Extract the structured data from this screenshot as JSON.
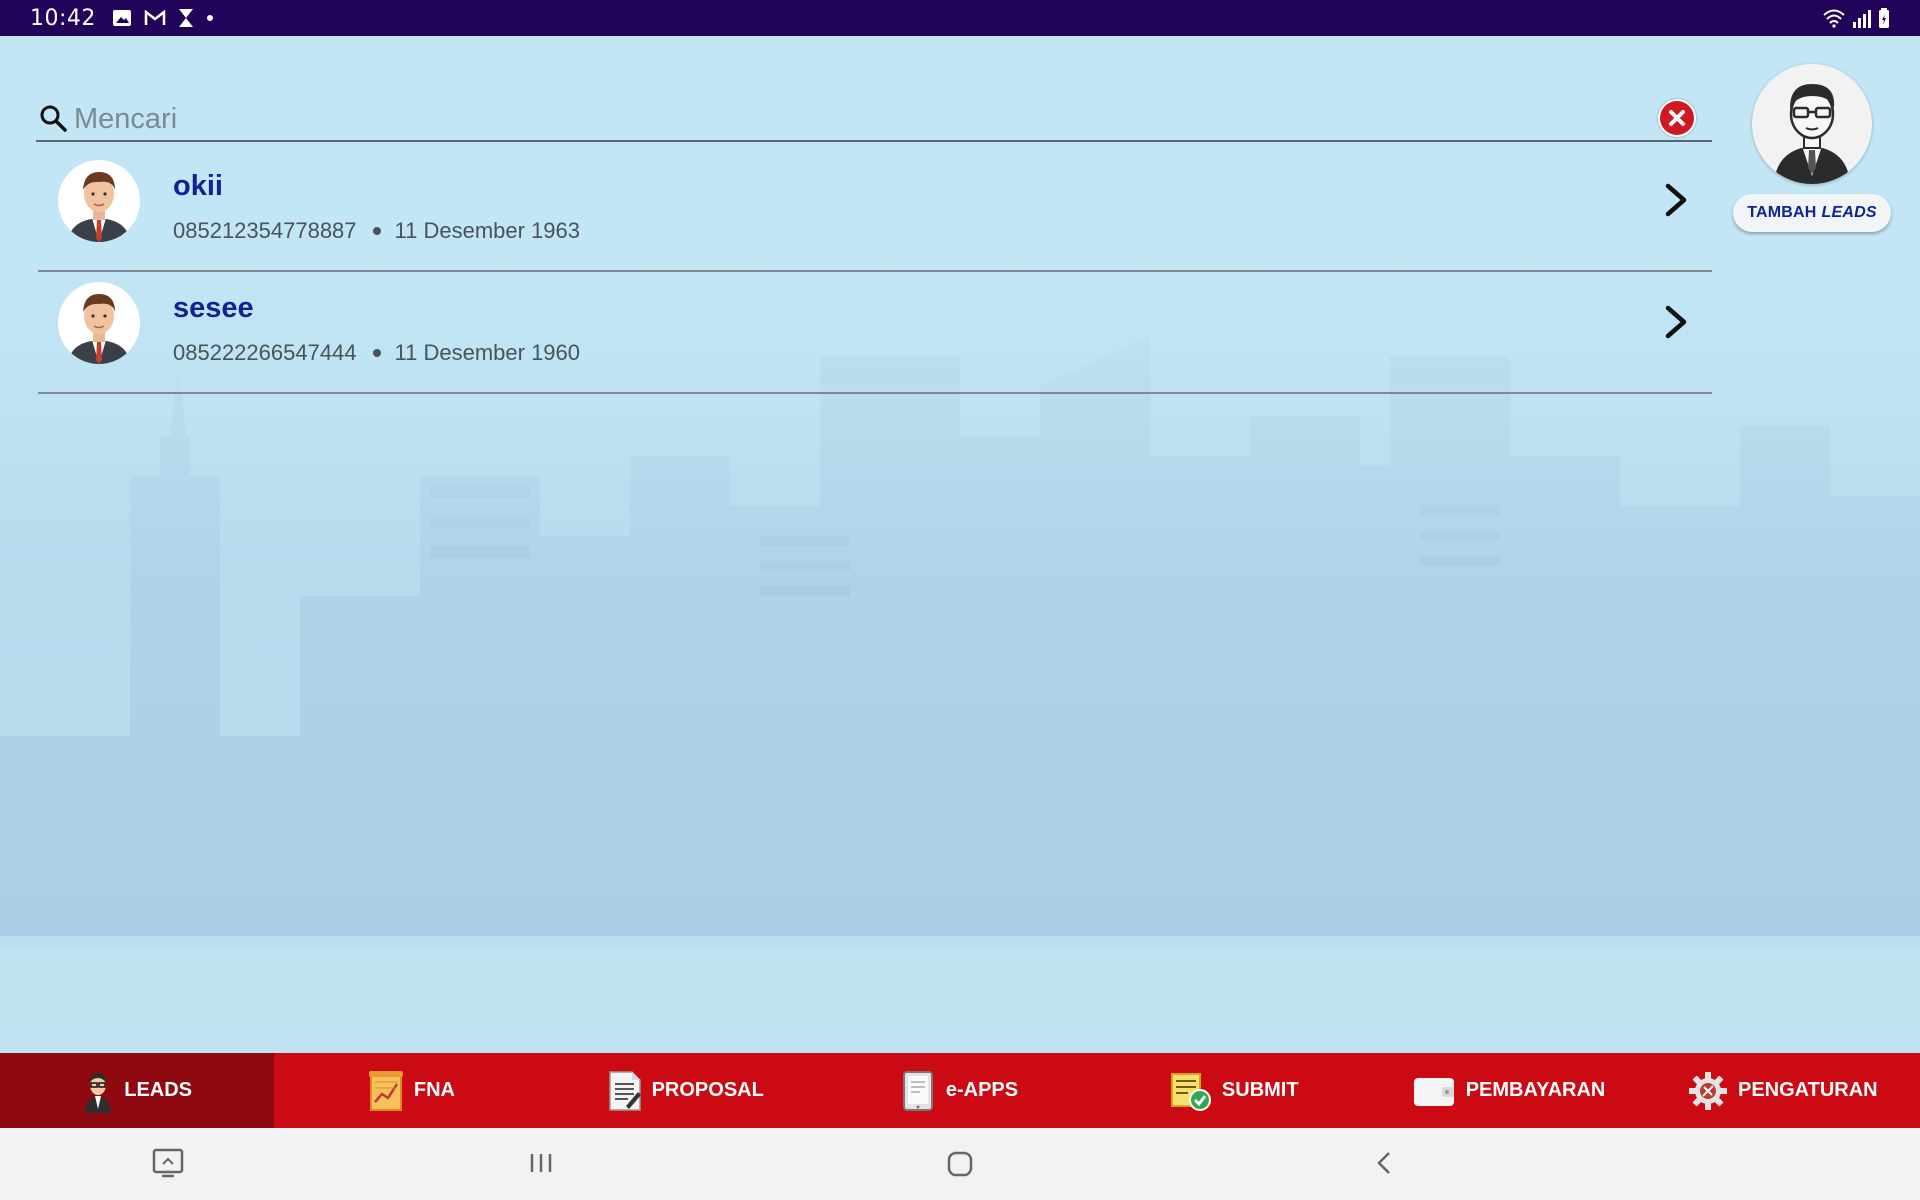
{
  "status_bar": {
    "time": "10:42",
    "icons": [
      "picture-icon",
      "gmail-icon",
      "hourglass-icon",
      "dot-icon"
    ],
    "right_icons": [
      "wifi-icon",
      "signal-icon",
      "battery-icon"
    ]
  },
  "search": {
    "placeholder": "Mencari",
    "value": ""
  },
  "leads": [
    {
      "name": "okii",
      "phone": "085212354778887",
      "birthdate": "11 Desember 1963"
    },
    {
      "name": "sesee",
      "phone": "085222266547444",
      "birthdate": "11 Desember 1960"
    }
  ],
  "add_leads": {
    "label": "TAMBAH",
    "label_italic": "LEADS"
  },
  "bottom_nav": [
    {
      "label": "LEADS",
      "icon": "agent-icon",
      "active": true
    },
    {
      "label": "FNA",
      "icon": "chart-paper-icon",
      "active": false
    },
    {
      "label": "PROPOSAL",
      "icon": "document-icon",
      "active": false
    },
    {
      "label": "e-APPS",
      "icon": "tablet-icon",
      "active": false
    },
    {
      "label": "SUBMIT",
      "icon": "checklist-icon",
      "active": false
    },
    {
      "label": "PEMBAYARAN",
      "icon": "wallet-icon",
      "active": false
    },
    {
      "label": "PENGATURAN",
      "icon": "gear-icon",
      "active": false
    }
  ],
  "colors": {
    "status_bar": "#21045a",
    "nav_red": "#cc0a14",
    "nav_active": "#8f0a10",
    "name_blue": "#0d2493",
    "clear_red": "#d01a23"
  }
}
